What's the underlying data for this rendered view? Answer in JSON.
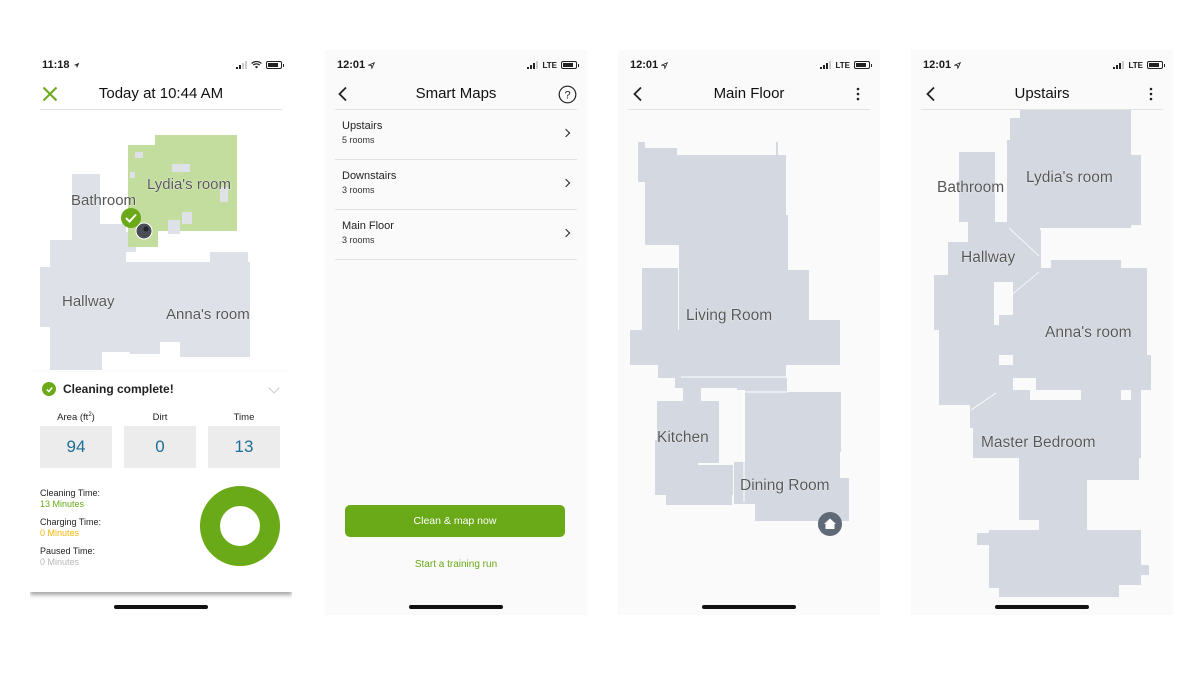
{
  "colors": {
    "accent_green": "#6aa917",
    "map_room": "#d3d8e1",
    "map_cleaned": "#c3dd9e",
    "stat_value": "#1c6f95",
    "charging_yellow": "#f2b705",
    "paused_gray": "#b8b8b8"
  },
  "panels": [
    {
      "status": {
        "time": "11:18",
        "location_icon": "location-arrow-icon",
        "network": "wifi"
      },
      "header": {
        "title": "Today at 10:44 AM",
        "left_icon": "close-icon"
      },
      "map": {
        "rooms": [
          "Lydia's room",
          "Bathroom",
          "Hallway",
          "Anna's room"
        ],
        "cleaned_room": "Lydia's room",
        "markers": [
          "check-marker-icon",
          "robot-icon"
        ]
      },
      "summary": {
        "status_text": "Cleaning complete!",
        "stats": [
          {
            "label": "Area (ft",
            "label_sup": "2",
            "label_end": ")",
            "value": "94"
          },
          {
            "label": "Dirt",
            "value": "0"
          },
          {
            "label": "Time",
            "value": "13"
          }
        ],
        "times": [
          {
            "label": "Cleaning Time:",
            "value": "13 Minutes"
          },
          {
            "label": "Charging Time:",
            "value": "0 Minutes"
          },
          {
            "label": "Paused Time:",
            "value": "0 Minutes"
          }
        ],
        "donut_cleaning_fraction": 1.0
      }
    },
    {
      "status": {
        "time": "12:01",
        "network": "LTE"
      },
      "header": {
        "title": "Smart Maps",
        "left_icon": "back-icon",
        "right_icon": "help-icon",
        "help_glyph": "?"
      },
      "maps": [
        {
          "name": "Upstairs",
          "rooms": "5 rooms"
        },
        {
          "name": "Downstairs",
          "rooms": "3 rooms"
        },
        {
          "name": "Main Floor",
          "rooms": "3 rooms"
        }
      ],
      "primary_button": "Clean & map now",
      "secondary_link": "Start a training run"
    },
    {
      "status": {
        "time": "12:01",
        "network": "LTE"
      },
      "header": {
        "title": "Main Floor",
        "left_icon": "back-icon",
        "right_icon": "more-vertical-icon"
      },
      "map": {
        "rooms": [
          "Living Room",
          "Kitchen",
          "Dining Room"
        ],
        "markers": [
          "home-base-icon"
        ]
      }
    },
    {
      "status": {
        "time": "12:01",
        "network": "LTE"
      },
      "header": {
        "title": "Upstairs",
        "left_icon": "back-icon",
        "right_icon": "more-vertical-icon"
      },
      "map": {
        "rooms": [
          "Bathroom",
          "Lydia's room",
          "Hallway",
          "Anna's room",
          "Master Bedroom"
        ]
      }
    }
  ]
}
